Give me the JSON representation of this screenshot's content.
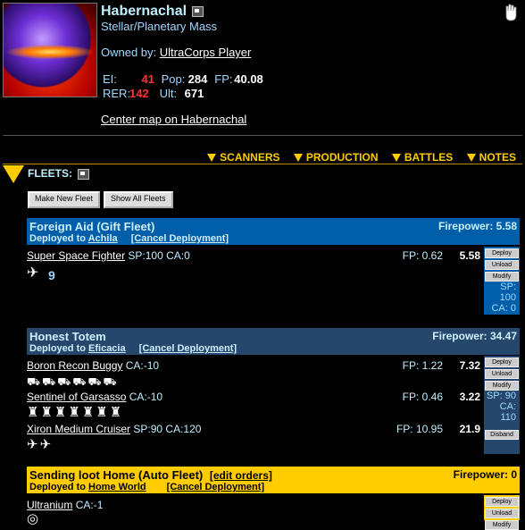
{
  "planet": {
    "name": "Habernachal",
    "type": "Stellar/Planetary Mass",
    "owned_prefix": "Owned by:",
    "owner": "UltraCorps Player",
    "stats": {
      "ei_label": "EI:",
      "ei_value": "41",
      "pop_label": "Pop:",
      "pop_value": "284",
      "fp_label": "FP:",
      "fp_value": "40.08",
      "rer_label": "RER:",
      "rer_value": "142",
      "ult_label": "Ult:",
      "ult_value": "671"
    },
    "center_map_link": "Center map on Habernachal"
  },
  "tabs": [
    "SCANNERS",
    "PRODUCTION",
    "BATTLES",
    "NOTES"
  ],
  "fleets_header": "FLEETS:",
  "buttons": {
    "make_new_fleet": "Make New Fleet",
    "show_all_fleets": "Show All Fleets"
  },
  "side_buttons": {
    "deploy": "Deploy",
    "unload": "Unload",
    "modify": "Modify",
    "disband": "Disband"
  },
  "fleets": [
    {
      "title": "Foreign Aid (Gift Fleet)",
      "firepower_label": "Firepower: 5.58",
      "deployed_prefix": "Deployed to",
      "deployed_target": "Achila",
      "cancel": "[Cancel Deployment]",
      "sp": "SP: 100",
      "ca": "CA: 0",
      "ships": [
        {
          "name": "Super Space Fighter",
          "meta": "SP:100 CA:0",
          "fp": "FP: 0.62",
          "fp_value": "5.58",
          "count": "9"
        }
      ]
    },
    {
      "title": "Honest Totem",
      "firepower_label": "Firepower: 34.47",
      "deployed_prefix": "Deployed to",
      "deployed_target": "Eficacia",
      "cancel": "[Cancel Deployment]",
      "sp": "SP: 90",
      "ca": "CA: 110",
      "ships": [
        {
          "name": "Boron Recon Buggy",
          "meta": "CA:-10",
          "fp": "FP: 1.22",
          "fp_value": "7.32"
        },
        {
          "name": "Sentinel of Garsasso",
          "meta": "CA:-10",
          "fp": "FP: 0.46",
          "fp_value": "3.22"
        },
        {
          "name": "Xiron Medium Cruiser",
          "meta": "SP:90 CA:120",
          "fp": "FP: 10.95",
          "fp_value": "21.9"
        }
      ]
    },
    {
      "title": "Sending loot Home (Auto Fleet)",
      "edit": "[edit orders]",
      "firepower_label": "Firepower: 0",
      "deployed_prefix": "Deployed to",
      "deployed_target": "Home World",
      "cancel": "[Cancel Deployment]",
      "ships": [
        {
          "name": "Ultranium",
          "meta": "CA:-1"
        }
      ]
    }
  ]
}
